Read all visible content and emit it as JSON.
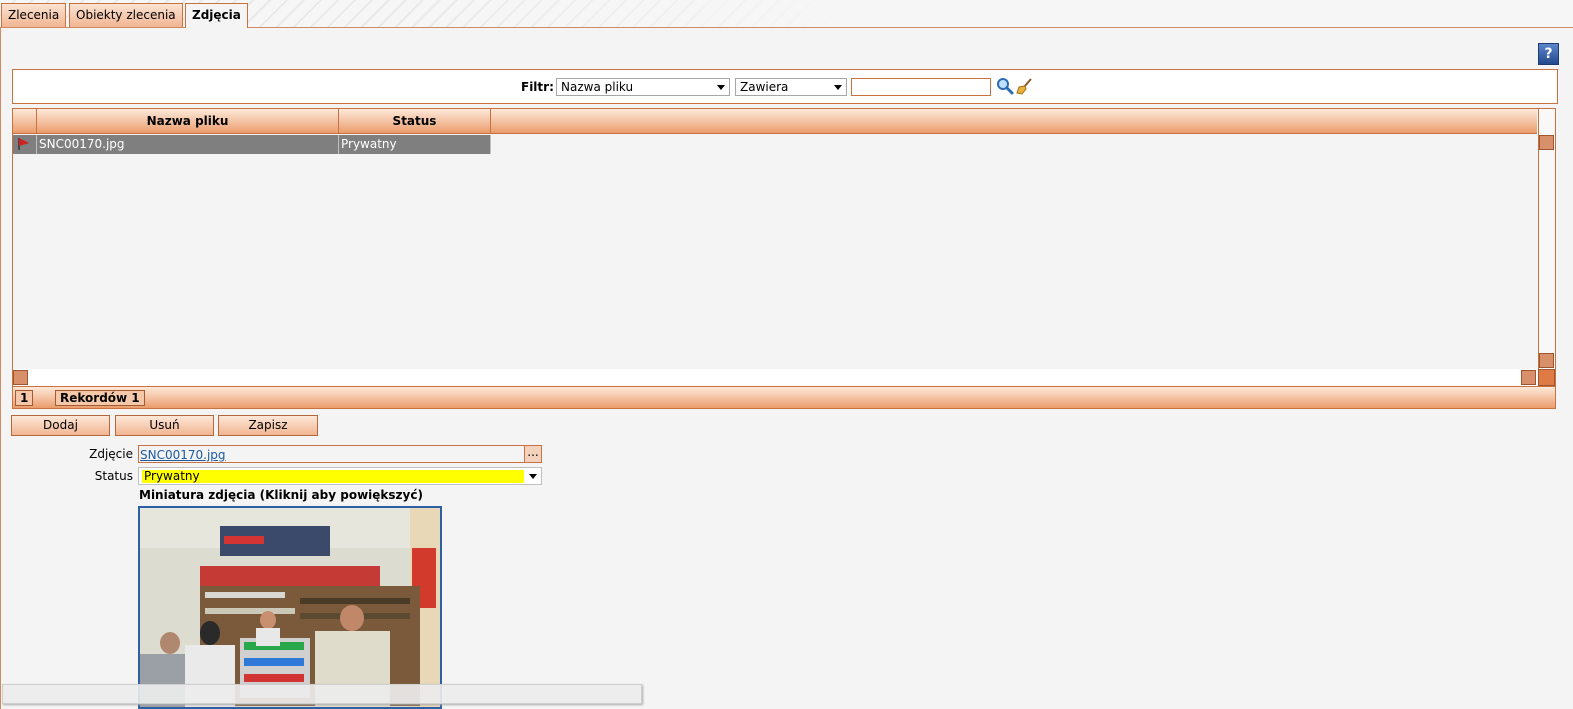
{
  "tabs": [
    {
      "label": "Zlecenia",
      "active": false
    },
    {
      "label": "Obiekty zlecenia",
      "active": false
    },
    {
      "label": "Zdjęcia",
      "active": true
    }
  ],
  "help": {
    "label": "?"
  },
  "filter": {
    "label": "Filtr:",
    "field_select": "Nazwa pliku",
    "operator_select": "Zawiera",
    "value": "",
    "search_icon": "search-icon",
    "clear_icon": "broom-icon"
  },
  "grid": {
    "columns": [
      "Nazwa pliku",
      "Status"
    ],
    "rows": [
      {
        "file": "SNC00170.jpg",
        "status": "Prywatny",
        "icon": "flag-icon"
      }
    ],
    "page": "1",
    "records": "Rekordów 1"
  },
  "actions": {
    "add": "Dodaj",
    "delete": "Usuń",
    "save": "Zapisz"
  },
  "form": {
    "photo_label": "Zdjęcie",
    "photo_value": "SNC00170.jpg",
    "browse": "...",
    "status_label": "Status",
    "status_value": "Prywatny",
    "thumbnail_title": "Miniatura zdjęcia (Kliknij aby powiększyć)"
  },
  "colors": {
    "accent": "#c9713f",
    "selected_row": "#7f7f7f",
    "status_highlight": "#ffff00"
  }
}
